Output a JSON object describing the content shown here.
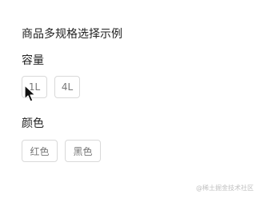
{
  "page": {
    "title": "商品多规格选择示例"
  },
  "sections": [
    {
      "label": "容量",
      "options": [
        "1L",
        "4L"
      ]
    },
    {
      "label": "颜色",
      "options": [
        "红色",
        "黑色"
      ]
    }
  ],
  "watermark": "@稀土掘金技术社区",
  "icons": {
    "cursor": "mouse-pointer-icon"
  }
}
